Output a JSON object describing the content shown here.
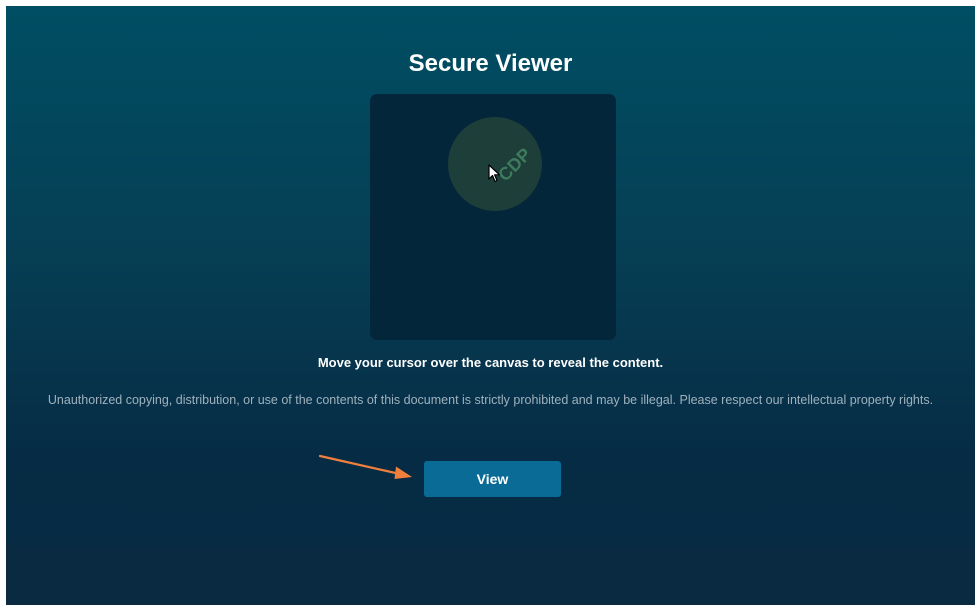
{
  "viewer": {
    "title": "Secure Viewer",
    "canvas_watermark_fragment": "CDP",
    "instruction": "Move your cursor over the canvas to reveal the content.",
    "disclaimer": "Unauthorized copying, distribution, or use of the contents of this document is strictly prohibited and may be illegal. Please respect our intellectual property rights.",
    "view_button_label": "View"
  },
  "icons": {
    "cursor": "mouse-pointer-icon",
    "annotation": "arrow-icon"
  },
  "colors": {
    "background_top": "#004e63",
    "background_bottom": "#072a42",
    "canvas": "#04263a",
    "lens": "#1d3e39",
    "button": "#0a6b97",
    "annotation_arrow": "#f07f3c",
    "disclaimer_text": "#9fb1bd"
  }
}
